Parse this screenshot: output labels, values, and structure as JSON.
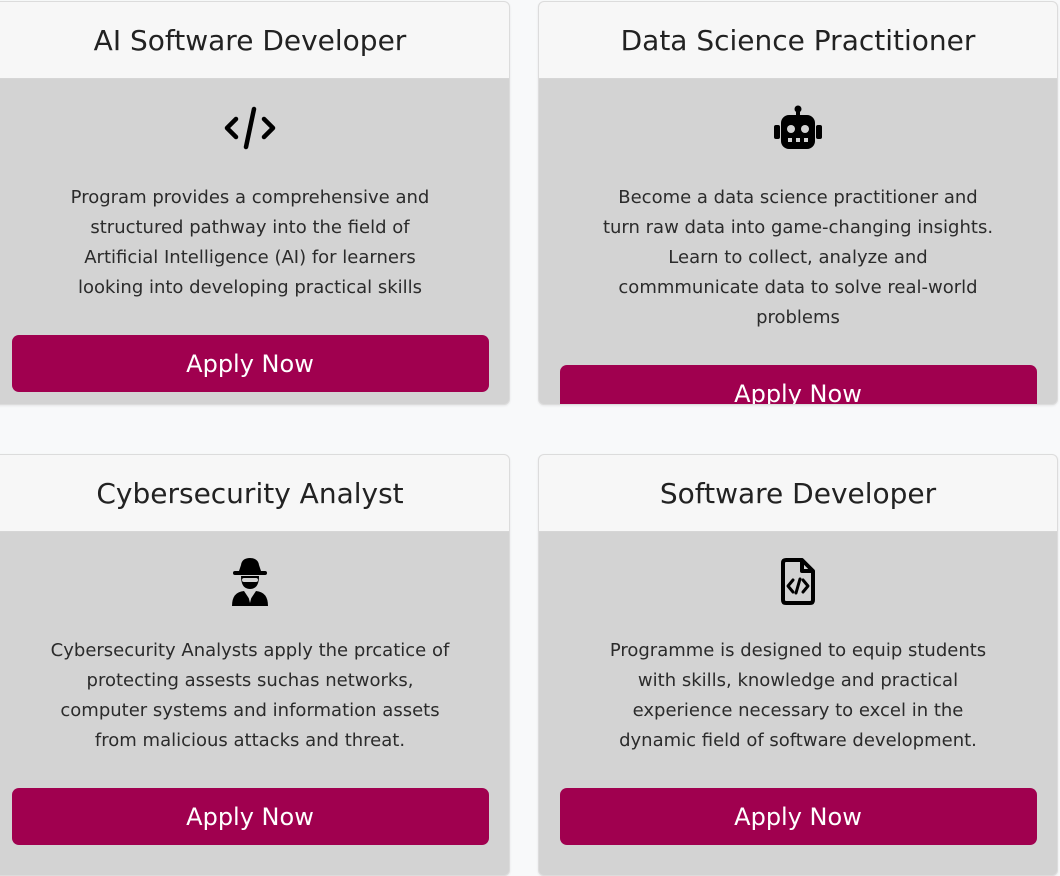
{
  "cards": [
    {
      "title": "AI Software Developer",
      "icon": "code-icon",
      "description": "Program provides a comprehensive and structured pathway into the field of Artificial Intelligence (AI) for learners looking into developing practical skills",
      "button_label": "Apply Now"
    },
    {
      "title": "Data Science Practitioner",
      "icon": "robot-icon",
      "description": "Become a data science practitioner and turn raw data into game-changing insights. Learn to collect, analyze and commmunicate data to solve real-world problems",
      "button_label": "Apply Now"
    },
    {
      "title": "Cybersecurity Analyst",
      "icon": "spy-icon",
      "description": "Cybersecurity Analysts apply the prcatice of protecting assests suchas networks, computer systems and information assets from malicious attacks and threat.",
      "button_label": "Apply Now"
    },
    {
      "title": "Software Developer",
      "icon": "file-code-icon",
      "description": "Programme is designed to equip students with skills, knowledge and practical experience necessary to excel in the dynamic field of software development.",
      "button_label": "Apply Now"
    }
  ],
  "colors": {
    "button": "#a0004f",
    "card_body": "#d3d3d3",
    "card_header": "#f7f7f7",
    "page_background": "#f8f9fa"
  }
}
